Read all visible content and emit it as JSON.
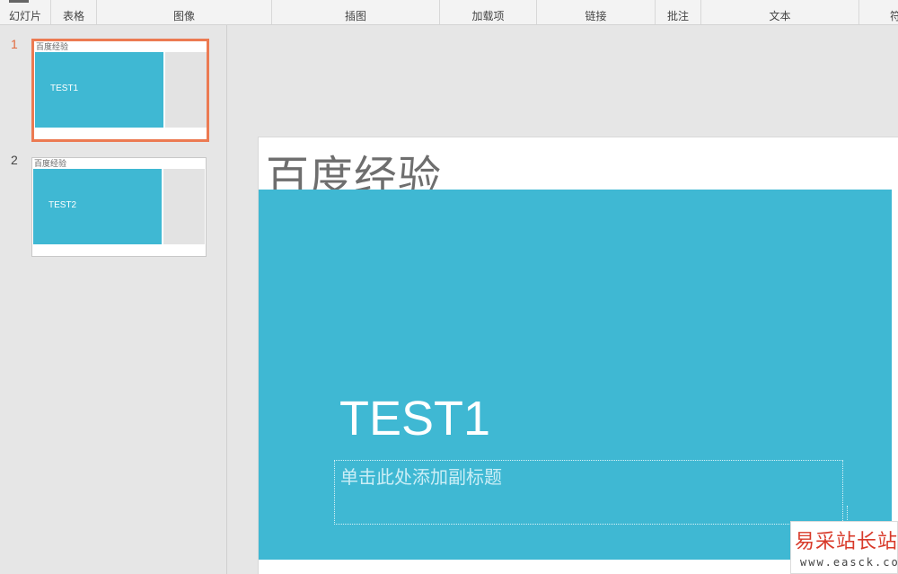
{
  "ribbon": {
    "groups": [
      {
        "label": "幻灯片"
      },
      {
        "label": "表格"
      },
      {
        "label": "图像"
      },
      {
        "label": "插图"
      },
      {
        "label": "加载项"
      },
      {
        "label": "链接"
      },
      {
        "label": "批注"
      },
      {
        "label": "文本"
      },
      {
        "label": "符"
      }
    ]
  },
  "thumbnails": [
    {
      "number": "1",
      "header": "百度经验",
      "text": "TEST1",
      "selected": true
    },
    {
      "number": "2",
      "header": "百度经验",
      "text": "TEST2",
      "selected": false
    }
  ],
  "slide": {
    "header": "百度经验",
    "title": "TEST1",
    "subtitle_placeholder": "单击此处添加副标题"
  },
  "colors": {
    "accent": "#3fb8d3",
    "selection": "#ec7a52",
    "background": "#e6e6e6"
  },
  "watermark": {
    "main": "易采站长站",
    "url": "www.easck.com"
  }
}
